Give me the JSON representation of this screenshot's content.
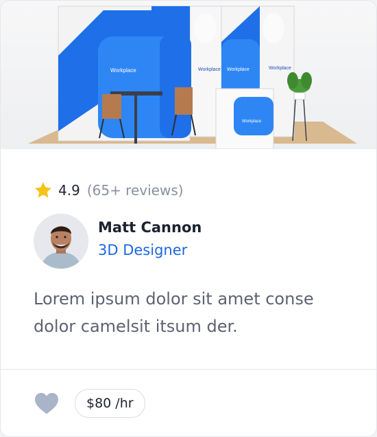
{
  "hero": {
    "brand_labels": [
      "Workplace",
      "Workplace",
      "Workplace",
      "Workplace",
      "Workplace"
    ],
    "brand_color": "#1f6fe8"
  },
  "rating": {
    "value": "4.9",
    "count": "(65+ reviews)",
    "star_color": "#f7c21a",
    "icon": "star-icon"
  },
  "designer": {
    "name": "Matt Cannon",
    "role": "3D Designer",
    "role_color": "#1a66e0"
  },
  "description": "Lorem ipsum dolor sit amet conse dolor camelsit itsum der.",
  "footer": {
    "favorite_icon": "heart-icon",
    "price": "$80 /hr"
  }
}
